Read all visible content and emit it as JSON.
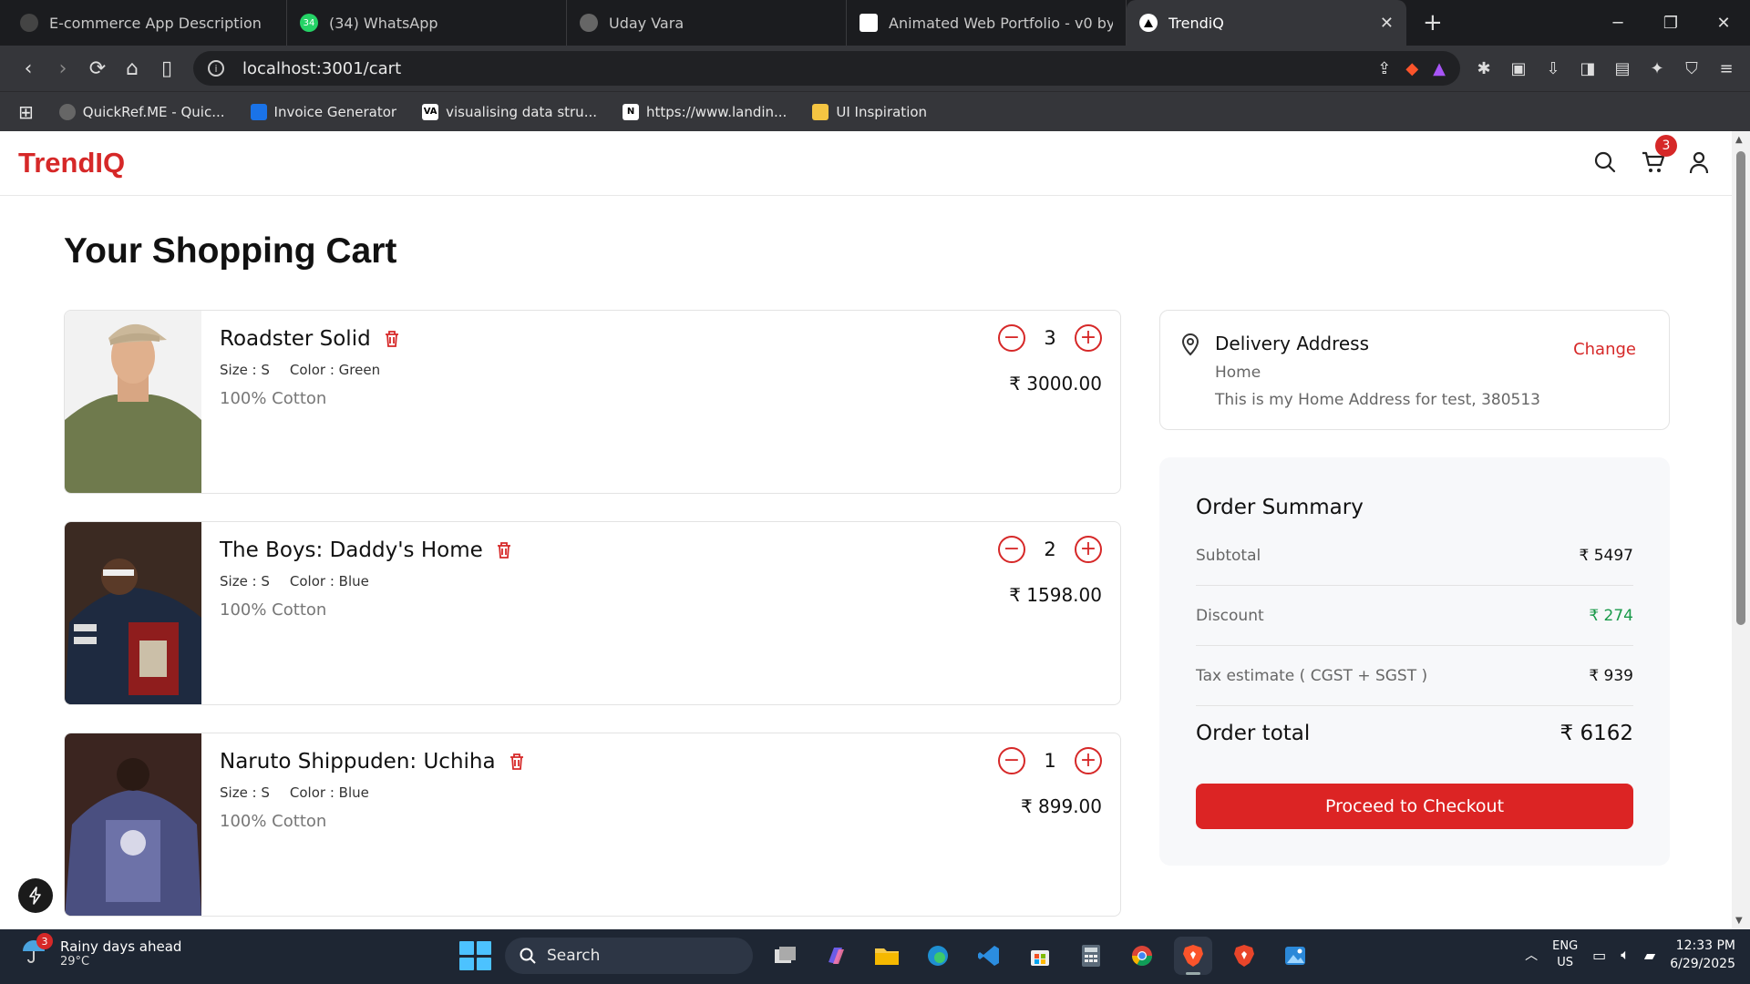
{
  "browser": {
    "tabs": [
      {
        "label": "E-commerce App Description",
        "fav_color": "#444"
      },
      {
        "label": "(34) WhatsApp",
        "fav_color": "#25d366",
        "fav_text": "34"
      },
      {
        "label": "Uday Vara",
        "fav_color": "#666"
      },
      {
        "label": "Animated Web Portfolio - v0 by Vercel",
        "fav_color": "#fff"
      },
      {
        "label": "TrendiQ",
        "fav_color": "#fff",
        "active": true
      }
    ],
    "url": "localhost:3001/cart",
    "bookmarks": [
      {
        "label": "QuickRef.ME - Quic...",
        "color": "#666"
      },
      {
        "label": "Invoice Generator",
        "color": "#1a73e8"
      },
      {
        "label": "visualising data stru...",
        "color": "#fff",
        "glyph": "VA"
      },
      {
        "label": "https://www.landin...",
        "color": "#fff",
        "glyph": "N"
      },
      {
        "label": "UI Inspiration",
        "color": "#f5c542"
      }
    ]
  },
  "site": {
    "logo": "TrendIQ",
    "cart_count": "3",
    "accent": "#d62828"
  },
  "cart": {
    "title": "Your Shopping Cart",
    "items": [
      {
        "name": "Roadster Solid",
        "size": "Size : S",
        "color": "Color : Green",
        "material": "100% Cotton",
        "qty": "3",
        "price": "₹ 3000.00"
      },
      {
        "name": "The Boys: Daddy's Home",
        "size": "Size : S",
        "color": "Color : Blue",
        "material": "100% Cotton",
        "qty": "2",
        "price": "₹ 1598.00"
      },
      {
        "name": "Naruto Shippuden: Uchiha",
        "size": "Size : S",
        "color": "Color : Blue",
        "material": "100% Cotton",
        "qty": "1",
        "price": "₹ 899.00"
      }
    ]
  },
  "delivery": {
    "title": "Delivery Address",
    "label": "Home",
    "address": "This is my Home Address for test, 380513",
    "change": "Change"
  },
  "summary": {
    "title": "Order Summary",
    "subtotal_label": "Subtotal",
    "subtotal": "₹ 5497",
    "discount_label": "Discount",
    "discount": "₹ 274",
    "tax_label": "Tax estimate ( CGST + SGST )",
    "tax": "₹ 939",
    "total_label": "Order total",
    "total": "₹ 6162",
    "checkout": "Proceed to Checkout"
  },
  "taskbar": {
    "weather_badge": "3",
    "weather_title": "Rainy days ahead",
    "weather_temp": "29°C",
    "search": "Search",
    "lang1": "ENG",
    "lang2": "US",
    "time": "12:33 PM",
    "date": "6/29/2025"
  }
}
